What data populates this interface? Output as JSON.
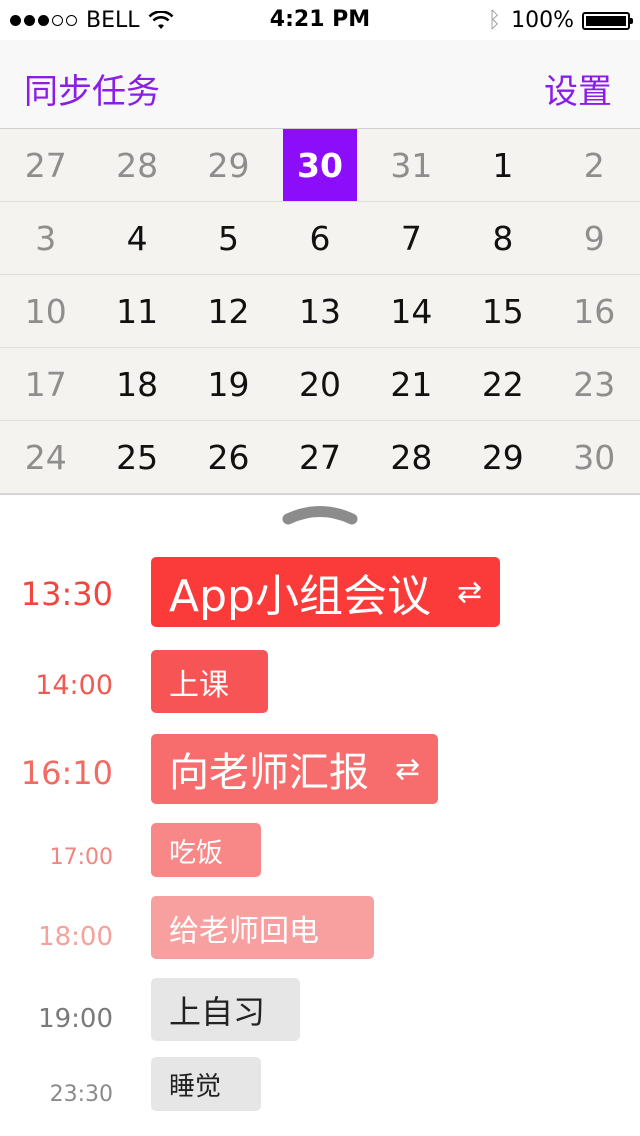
{
  "status_bar": {
    "carrier": "BELL",
    "time": "4:21 PM",
    "battery": "100%"
  },
  "nav": {
    "left": "同步任务",
    "right": "设置"
  },
  "calendar": {
    "selected": "30",
    "rows": [
      [
        "27",
        "28",
        "29",
        "30",
        "31",
        "1",
        "2"
      ],
      [
        "3",
        "4",
        "5",
        "6",
        "7",
        "8",
        "9"
      ],
      [
        "10",
        "11",
        "12",
        "13",
        "14",
        "15",
        "16"
      ],
      [
        "17",
        "18",
        "19",
        "20",
        "21",
        "22",
        "23"
      ],
      [
        "24",
        "25",
        "26",
        "27",
        "28",
        "29",
        "30"
      ]
    ]
  },
  "events": [
    {
      "time": "13:30",
      "title": "App小组会议",
      "repeat": "⇄",
      "color": "#fb3a3a",
      "time_color": "#f1463f"
    },
    {
      "time": "14:00",
      "title": "上课",
      "repeat": "",
      "color": "#f75555",
      "time_color": "#ef5a52"
    },
    {
      "time": "16:10",
      "title": "向老师汇报",
      "repeat": "⇄",
      "color": "#f76d6d",
      "time_color": "#f26b62"
    },
    {
      "time": "17:00",
      "title": "吃饭",
      "repeat": "",
      "color": "#f88787",
      "time_color": "#f2857f"
    },
    {
      "time": "18:00",
      "title": "给老师回电",
      "repeat": "",
      "color": "#f89f9f",
      "time_color": "#f5a19c"
    },
    {
      "time": "19:00",
      "title": "上自习",
      "repeat": "",
      "color": "#e6e6e6",
      "time_color": "#7a7a7a"
    },
    {
      "time": "23:30",
      "title": "睡觉",
      "repeat": "",
      "color": "#e6e6e6",
      "time_color": "#8a8a8a"
    }
  ]
}
